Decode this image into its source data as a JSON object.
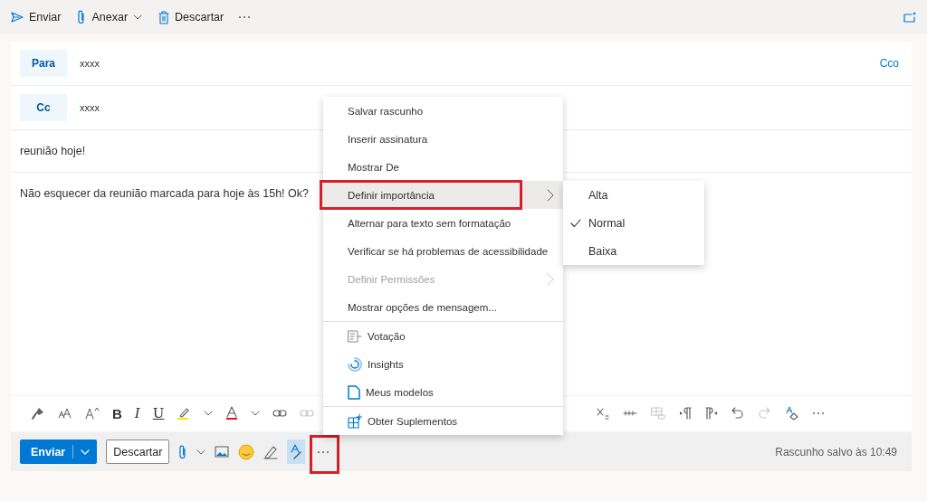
{
  "command_bar": {
    "send": "Enviar",
    "attach": "Anexar",
    "discard": "Descartar"
  },
  "recipients": [
    {
      "label": "Para",
      "value": "xxxx",
      "extra": "Cco"
    },
    {
      "label": "Cc",
      "value": "xxxx"
    }
  ],
  "subject": "reunião hoje!",
  "body": "Não esquecer da reunião marcada para hoje às 15h! Ok?",
  "format_toolbar": {
    "bold": "B",
    "italic": "I",
    "underline": "U"
  },
  "menu": {
    "sections": [
      [
        {
          "label": "Salvar rascunho",
          "kind": "text",
          "disabled": false,
          "submenu": false,
          "highlighted": false,
          "annotated": false
        },
        {
          "label": "Inserir assinatura",
          "kind": "text",
          "disabled": false,
          "submenu": false,
          "highlighted": false,
          "annotated": false
        },
        {
          "label": "Mostrar De",
          "kind": "text",
          "disabled": false,
          "submenu": false,
          "highlighted": false,
          "annotated": false
        },
        {
          "label": "Definir importância",
          "kind": "text",
          "disabled": false,
          "submenu": true,
          "highlighted": true,
          "annotated": true
        },
        {
          "label": "Alternar para texto sem formatação",
          "kind": "text",
          "disabled": false,
          "submenu": false,
          "highlighted": false,
          "annotated": false
        },
        {
          "label": "Verificar se há problemas de acessibilidade",
          "kind": "text",
          "disabled": false,
          "submenu": false,
          "highlighted": false,
          "annotated": false
        },
        {
          "label": "Definir Permissões",
          "kind": "text",
          "disabled": true,
          "submenu": true,
          "highlighted": false,
          "annotated": false
        },
        {
          "label": "Mostrar opções de mensagem...",
          "kind": "text",
          "disabled": false,
          "submenu": false,
          "highlighted": false,
          "annotated": false
        }
      ],
      [
        {
          "label": "Votação",
          "kind": "poll",
          "disabled": false,
          "submenu": false,
          "highlighted": false,
          "annotated": false
        },
        {
          "label": "Insights",
          "kind": "insights",
          "disabled": false,
          "submenu": false,
          "highlighted": false,
          "annotated": false
        },
        {
          "label": "Meus modelos",
          "kind": "templates",
          "disabled": false,
          "submenu": false,
          "highlighted": false,
          "annotated": false
        }
      ],
      [
        {
          "label": "Obter Suplementos",
          "kind": "addins",
          "disabled": false,
          "submenu": false,
          "highlighted": false,
          "annotated": false
        }
      ]
    ]
  },
  "submenu": [
    {
      "label": "Alta",
      "checked": false
    },
    {
      "label": "Normal",
      "checked": true
    },
    {
      "label": "Baixa",
      "checked": false
    }
  ],
  "action_bar": {
    "send": "Enviar",
    "discard": "Descartar",
    "editor_selected": true,
    "more_annotated": true,
    "status": "Rascunho salvo às 10:49"
  }
}
